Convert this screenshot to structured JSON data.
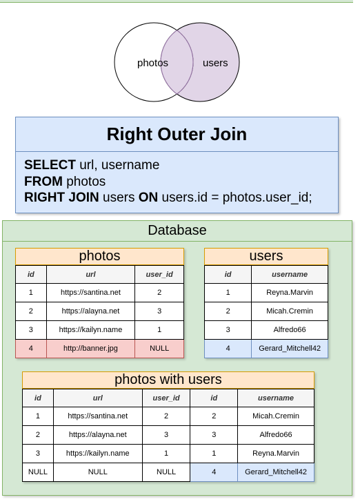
{
  "venn": {
    "left_label": "photos",
    "right_label": "users"
  },
  "title": "Right Outer Join",
  "sql": [
    {
      "kw": "SELECT",
      "text": " url, username"
    },
    {
      "kw": "FROM",
      "text": " photos"
    },
    {
      "kw": "RIGHT JOIN",
      "text": " users ",
      "kw2": "ON",
      "text2": " users.id = photos.user_id;"
    }
  ],
  "database_title": "Database",
  "photos_table": {
    "title": "photos",
    "columns": [
      "id",
      "url",
      "user_id"
    ],
    "rows": [
      [
        "1",
        "https://santina.net",
        "2"
      ],
      [
        "2",
        "https://alayna.net",
        "3"
      ],
      [
        "3",
        "https://kailyn.name",
        "1"
      ],
      [
        "4",
        "http://banner.jpg",
        "NULL"
      ]
    ]
  },
  "users_table": {
    "title": "users",
    "columns": [
      "id",
      "username"
    ],
    "rows": [
      [
        "1",
        "Reyna.Marvin"
      ],
      [
        "2",
        "Micah.Cremin"
      ],
      [
        "3",
        "Alfredo66"
      ],
      [
        "4",
        "Gerard_Mitchell42"
      ]
    ]
  },
  "result_table": {
    "title": "photos with users",
    "columns": [
      "id",
      "url",
      "user_id",
      "id",
      "username"
    ],
    "rows": [
      [
        "1",
        "https://santina.net",
        "2",
        "2",
        "Micah.Cremin"
      ],
      [
        "2",
        "https://alayna.net",
        "3",
        "3",
        "Alfredo66"
      ],
      [
        "3",
        "https://kailyn.name",
        "1",
        "1",
        "Reyna.Marvin"
      ],
      [
        "NULL",
        "NULL",
        "NULL",
        "4",
        "Gerard_Mitchell42"
      ]
    ]
  },
  "colors": {
    "venn_fill": "#e1d5e7",
    "venn_stroke": "#9673a6",
    "blue_fill": "#dae8fc",
    "green_fill": "#d5e8d4",
    "orange_fill": "#ffe6cc",
    "red_fill": "#f8cecc"
  }
}
